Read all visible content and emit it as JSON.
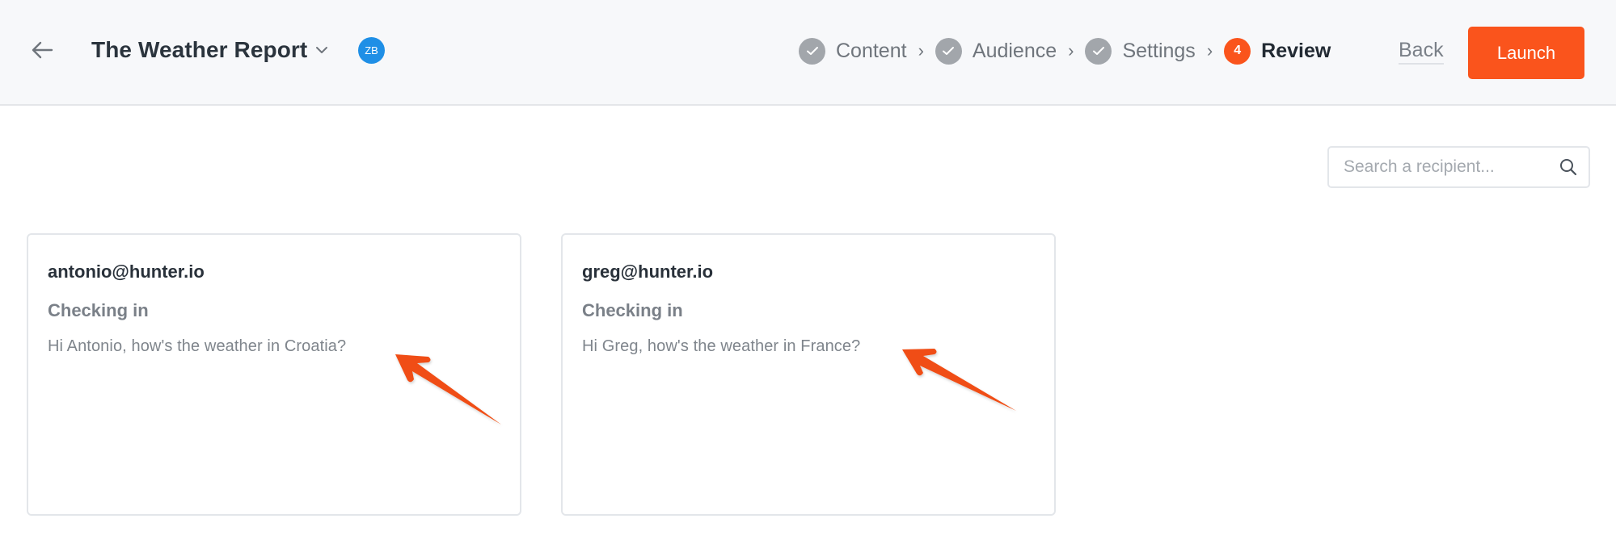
{
  "header": {
    "back_icon": "arrow-left-icon",
    "title": "The Weather Report",
    "title_dropdown_icon": "chevron-down-icon",
    "avatar_initials": "ZB",
    "avatar_color": "#1f8fe6",
    "steps": [
      {
        "label": "Content",
        "status": "complete",
        "icon": "check-icon"
      },
      {
        "label": "Audience",
        "status": "complete",
        "icon": "check-icon"
      },
      {
        "label": "Settings",
        "status": "complete",
        "icon": "check-icon"
      },
      {
        "label": "Review",
        "status": "active",
        "number": "4"
      }
    ],
    "step_separator": "›",
    "back_label": "Back",
    "launch_label": "Launch",
    "accent_color": "#fa541c"
  },
  "search": {
    "placeholder": "Search a recipient...",
    "value": "",
    "icon": "search-icon"
  },
  "recipients": [
    {
      "email": "antonio@hunter.io",
      "subject": "Checking in",
      "body": "Hi Antonio, how's the weather in Croatia?"
    },
    {
      "email": "greg@hunter.io",
      "subject": "Checking in",
      "body": "Hi Greg, how's the weather in France?"
    }
  ],
  "annotations": {
    "arrow_color": "#f04e12"
  }
}
